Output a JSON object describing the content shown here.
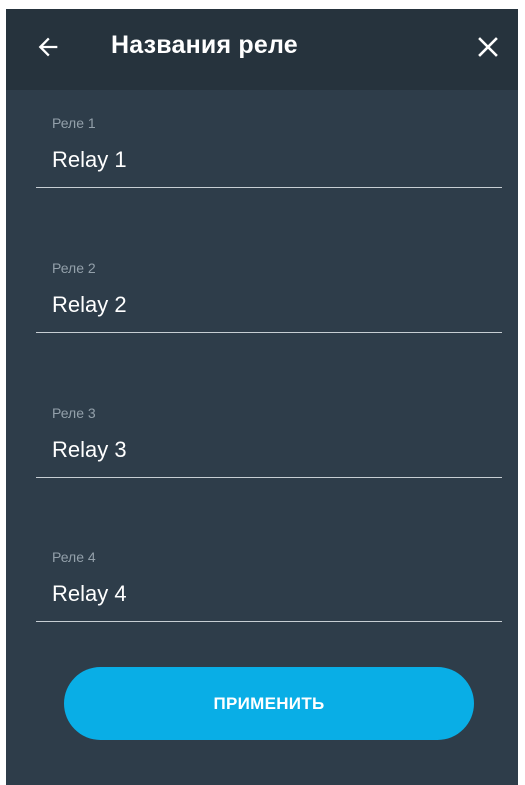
{
  "header": {
    "title": "Названия реле",
    "back_icon": "arrow-left-icon",
    "close_icon": "close-icon"
  },
  "fields": [
    {
      "label": "Реле 1",
      "value": "Relay 1"
    },
    {
      "label": "Реле 2",
      "value": "Relay 2"
    },
    {
      "label": "Реле 3",
      "value": "Relay 3"
    },
    {
      "label": "Реле 4",
      "value": "Relay 4"
    }
  ],
  "apply_button": {
    "label": "ПРИМЕНИТЬ"
  },
  "colors": {
    "background": "#2e3d4a",
    "topbar": "#26333d",
    "accent": "#09aee6",
    "label": "#93a0aa",
    "underline": "#c7ced3"
  }
}
